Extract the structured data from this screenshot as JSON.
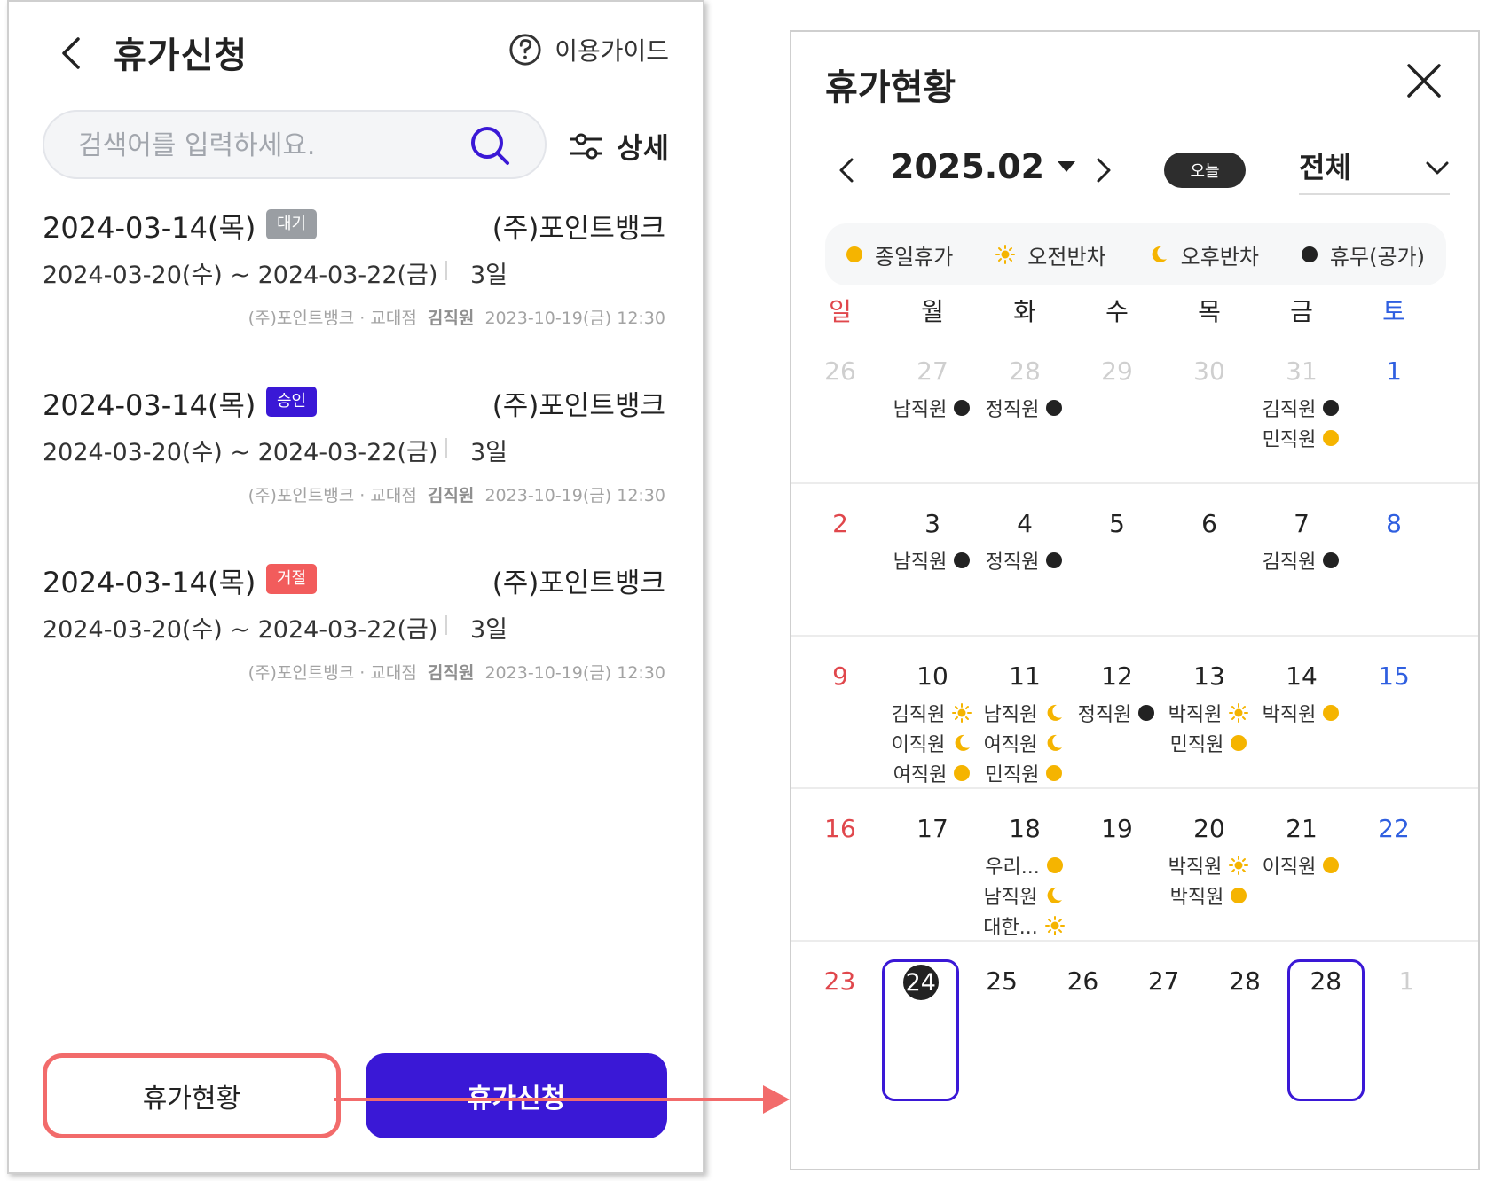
{
  "left": {
    "title": "휴가신청",
    "guide_label": "이용가이드",
    "search_placeholder": "검색어를 입력하세요.",
    "detail_label": "상세",
    "items": [
      {
        "date": "2024-03-14(목)",
        "badge": "대기",
        "badge_color": "#9a9ea3",
        "company": "(주)포인트뱅크",
        "range": "2024-03-20(수) ~ 2024-03-22(금)",
        "days": "3일",
        "meta_branch": "(주)포인트뱅크 · 교대점",
        "meta_name": "김직원",
        "meta_time": "2023-10-19(금) 12:30"
      },
      {
        "date": "2024-03-14(목)",
        "badge": "승인",
        "badge_color": "#3a18d6",
        "company": "(주)포인트뱅크",
        "range": "2024-03-20(수) ~ 2024-03-22(금)",
        "days": "3일",
        "meta_branch": "(주)포인트뱅크 · 교대점",
        "meta_name": "김직원",
        "meta_time": "2023-10-19(금) 12:30"
      },
      {
        "date": "2024-03-14(목)",
        "badge": "거절",
        "badge_color": "#f25c5c",
        "company": "(주)포인트뱅크",
        "range": "2024-03-20(수) ~ 2024-03-22(금)",
        "days": "3일",
        "meta_branch": "(주)포인트뱅크 · 교대점",
        "meta_name": "김직원",
        "meta_time": "2023-10-19(금) 12:30"
      }
    ],
    "btn_status": "휴가현황",
    "btn_apply": "휴가신청"
  },
  "right": {
    "title": "휴가현황",
    "month": "2025.02",
    "today_label": "오늘",
    "filter_label": "전체",
    "legend": [
      {
        "type": "full",
        "label": "종일휴가"
      },
      {
        "type": "am",
        "label": "오전반차"
      },
      {
        "type": "pm",
        "label": "오후반차"
      },
      {
        "type": "off",
        "label": "휴무(공가)"
      }
    ],
    "weekdays": [
      "일",
      "월",
      "화",
      "수",
      "목",
      "금",
      "토"
    ],
    "weeks": [
      {
        "days": [
          {
            "n": "26",
            "muted": true,
            "ev": []
          },
          {
            "n": "27",
            "muted": true,
            "ev": [
              {
                "name": "남직원",
                "type": "off"
              }
            ]
          },
          {
            "n": "28",
            "muted": true,
            "ev": [
              {
                "name": "정직원",
                "type": "off"
              }
            ]
          },
          {
            "n": "29",
            "muted": true,
            "ev": []
          },
          {
            "n": "30",
            "muted": true,
            "ev": []
          },
          {
            "n": "31",
            "muted": true,
            "ev": [
              {
                "name": "김직원",
                "type": "off"
              },
              {
                "name": "민직원",
                "type": "full"
              }
            ]
          },
          {
            "n": "1",
            "ev": []
          }
        ]
      },
      {
        "days": [
          {
            "n": "2",
            "ev": []
          },
          {
            "n": "3",
            "ev": [
              {
                "name": "남직원",
                "type": "off"
              }
            ]
          },
          {
            "n": "4",
            "ev": [
              {
                "name": "정직원",
                "type": "off"
              }
            ]
          },
          {
            "n": "5",
            "ev": []
          },
          {
            "n": "6",
            "ev": []
          },
          {
            "n": "7",
            "ev": [
              {
                "name": "김직원",
                "type": "off"
              }
            ]
          },
          {
            "n": "8",
            "ev": []
          }
        ]
      },
      {
        "days": [
          {
            "n": "9",
            "ev": []
          },
          {
            "n": "10",
            "ev": [
              {
                "name": "김직원",
                "type": "am"
              },
              {
                "name": "이직원",
                "type": "pm"
              },
              {
                "name": "여직원",
                "type": "full"
              }
            ]
          },
          {
            "n": "11",
            "ev": [
              {
                "name": "남직원",
                "type": "pm"
              },
              {
                "name": "여직원",
                "type": "pm"
              },
              {
                "name": "민직원",
                "type": "full"
              }
            ]
          },
          {
            "n": "12",
            "ev": [
              {
                "name": "정직원",
                "type": "off"
              }
            ]
          },
          {
            "n": "13",
            "ev": [
              {
                "name": "박직원",
                "type": "am"
              },
              {
                "name": "민직원",
                "type": "full"
              }
            ]
          },
          {
            "n": "14",
            "ev": [
              {
                "name": "박직원",
                "type": "full"
              }
            ]
          },
          {
            "n": "15",
            "ev": []
          }
        ]
      },
      {
        "days": [
          {
            "n": "16",
            "ev": []
          },
          {
            "n": "17",
            "ev": []
          },
          {
            "n": "18",
            "ev": [
              {
                "name": "우리...",
                "type": "full"
              },
              {
                "name": "남직원",
                "type": "pm"
              },
              {
                "name": "대한...",
                "type": "am"
              }
            ]
          },
          {
            "n": "19",
            "ev": []
          },
          {
            "n": "20",
            "ev": [
              {
                "name": "박직원",
                "type": "am"
              },
              {
                "name": "박직원",
                "type": "full"
              }
            ]
          },
          {
            "n": "21",
            "ev": [
              {
                "name": "이직원",
                "type": "full"
              }
            ]
          },
          {
            "n": "22",
            "ev": []
          }
        ]
      },
      {
        "days": [
          {
            "n": "23",
            "ev": []
          },
          {
            "n": "24",
            "today": true,
            "ev": []
          },
          {
            "n": "25",
            "ev": []
          },
          {
            "n": "26",
            "ev": []
          },
          {
            "n": "27",
            "ev": []
          },
          {
            "n": "28",
            "ev": []
          },
          {
            "n": "28",
            "selected": true,
            "ev": []
          },
          {
            "n": "1",
            "muted": true,
            "ev": []
          }
        ]
      }
    ],
    "colors": {
      "full": "#f5b400",
      "off": "#222222",
      "sunday": "#e0474c",
      "saturday": "#2f5fe0",
      "accent": "#3a18d6"
    }
  }
}
